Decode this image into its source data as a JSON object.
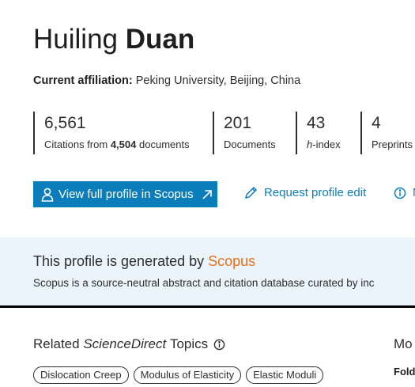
{
  "profile": {
    "first_name": "Huiling",
    "last_name": "Duan",
    "affiliation_label": "Current affiliation:",
    "affiliation_value": "Peking University, Beijing, China"
  },
  "metrics": {
    "citations": {
      "value": "6,561",
      "label_prefix": "Citations from",
      "documents_count": "4,504",
      "label_suffix": "documents"
    },
    "documents": {
      "value": "201",
      "label": "Documents"
    },
    "hindex": {
      "value": "43",
      "label_italic": "h",
      "label_rest": "-index"
    },
    "preprints": {
      "value": "4",
      "label": "Preprints"
    }
  },
  "actions": {
    "view_profile": "View full profile in Scopus",
    "request_edit": "Request profile edit",
    "more_partial": "N"
  },
  "banner": {
    "title_prefix": "This profile is generated by",
    "title_link": "Scopus",
    "description": "Scopus is a source-neutral abstract and citation database curated by inc"
  },
  "topics": {
    "title_prefix": "Related",
    "title_italic": "ScienceDirect",
    "title_suffix": "Topics",
    "chips": [
      "Dislocation Creep",
      "Modulus of Elasticity",
      "Elastic Moduli"
    ]
  },
  "side": {
    "title": "Mo",
    "subtitle": "Fold"
  },
  "colors": {
    "accent": "#0c7dbb",
    "scopus_orange": "#e9711c",
    "banner_bg": "#ebf3fb"
  },
  "icons": {
    "view_profile_leading": "user-icon",
    "view_profile_trailing": "external-link-icon",
    "request_edit": "pencil-icon",
    "more": "info-icon",
    "topics_info": "info-icon"
  }
}
